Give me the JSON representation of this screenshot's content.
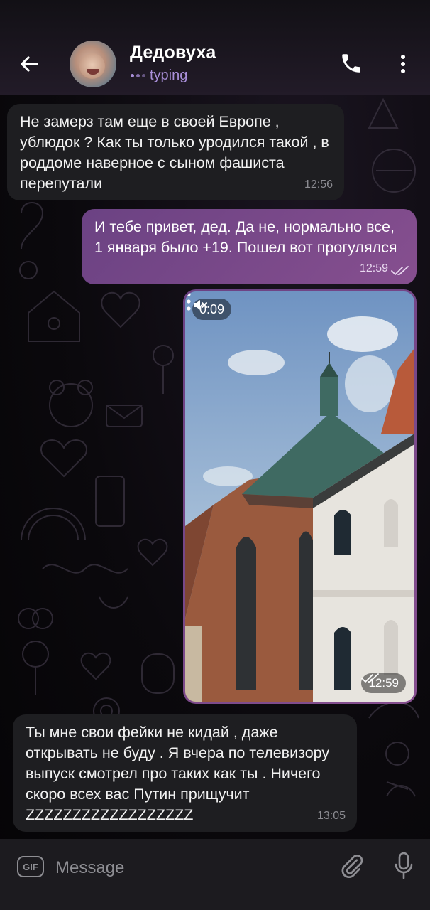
{
  "header": {
    "contact_name": "Дедовуха",
    "status": "typing",
    "back_icon": "arrow-left-icon",
    "call_icon": "phone-icon",
    "menu_icon": "more-vertical-icon"
  },
  "messages": [
    {
      "direction": "incoming",
      "text": "Не замерз там еще в своей Европе , ублюдок ? Как ты только уродился такой , в роддоме наверное с сыном фашиста перепутали",
      "time": "12:56"
    },
    {
      "direction": "outgoing",
      "text": "И тебе привет, дед. Да не, нормально все, 1 января было +19. Пошел вот прогулялся",
      "time": "12:59",
      "read": true
    },
    {
      "direction": "outgoing",
      "type": "video",
      "duration": "0:09",
      "muted": true,
      "time": "12:59",
      "read": true
    },
    {
      "direction": "incoming",
      "text": "Ты мне свои фейки не кидай , даже открывать не буду . Я вчера по телевизору выпуск смотрел про таких как ты . Ничего скоро всех вас Путин прищучит ZZZZZZZZZZZZZZZZZZ",
      "time": "13:05"
    }
  ],
  "composer": {
    "gif_label": "GIF",
    "placeholder": "Message",
    "attach_icon": "paperclip-icon",
    "mic_icon": "microphone-icon"
  },
  "colors": {
    "header_bg": "#1a1620",
    "incoming_bubble": "#1e1e21",
    "outgoing_bubble": "#7a4a8a",
    "accent": "#a98fd9"
  }
}
